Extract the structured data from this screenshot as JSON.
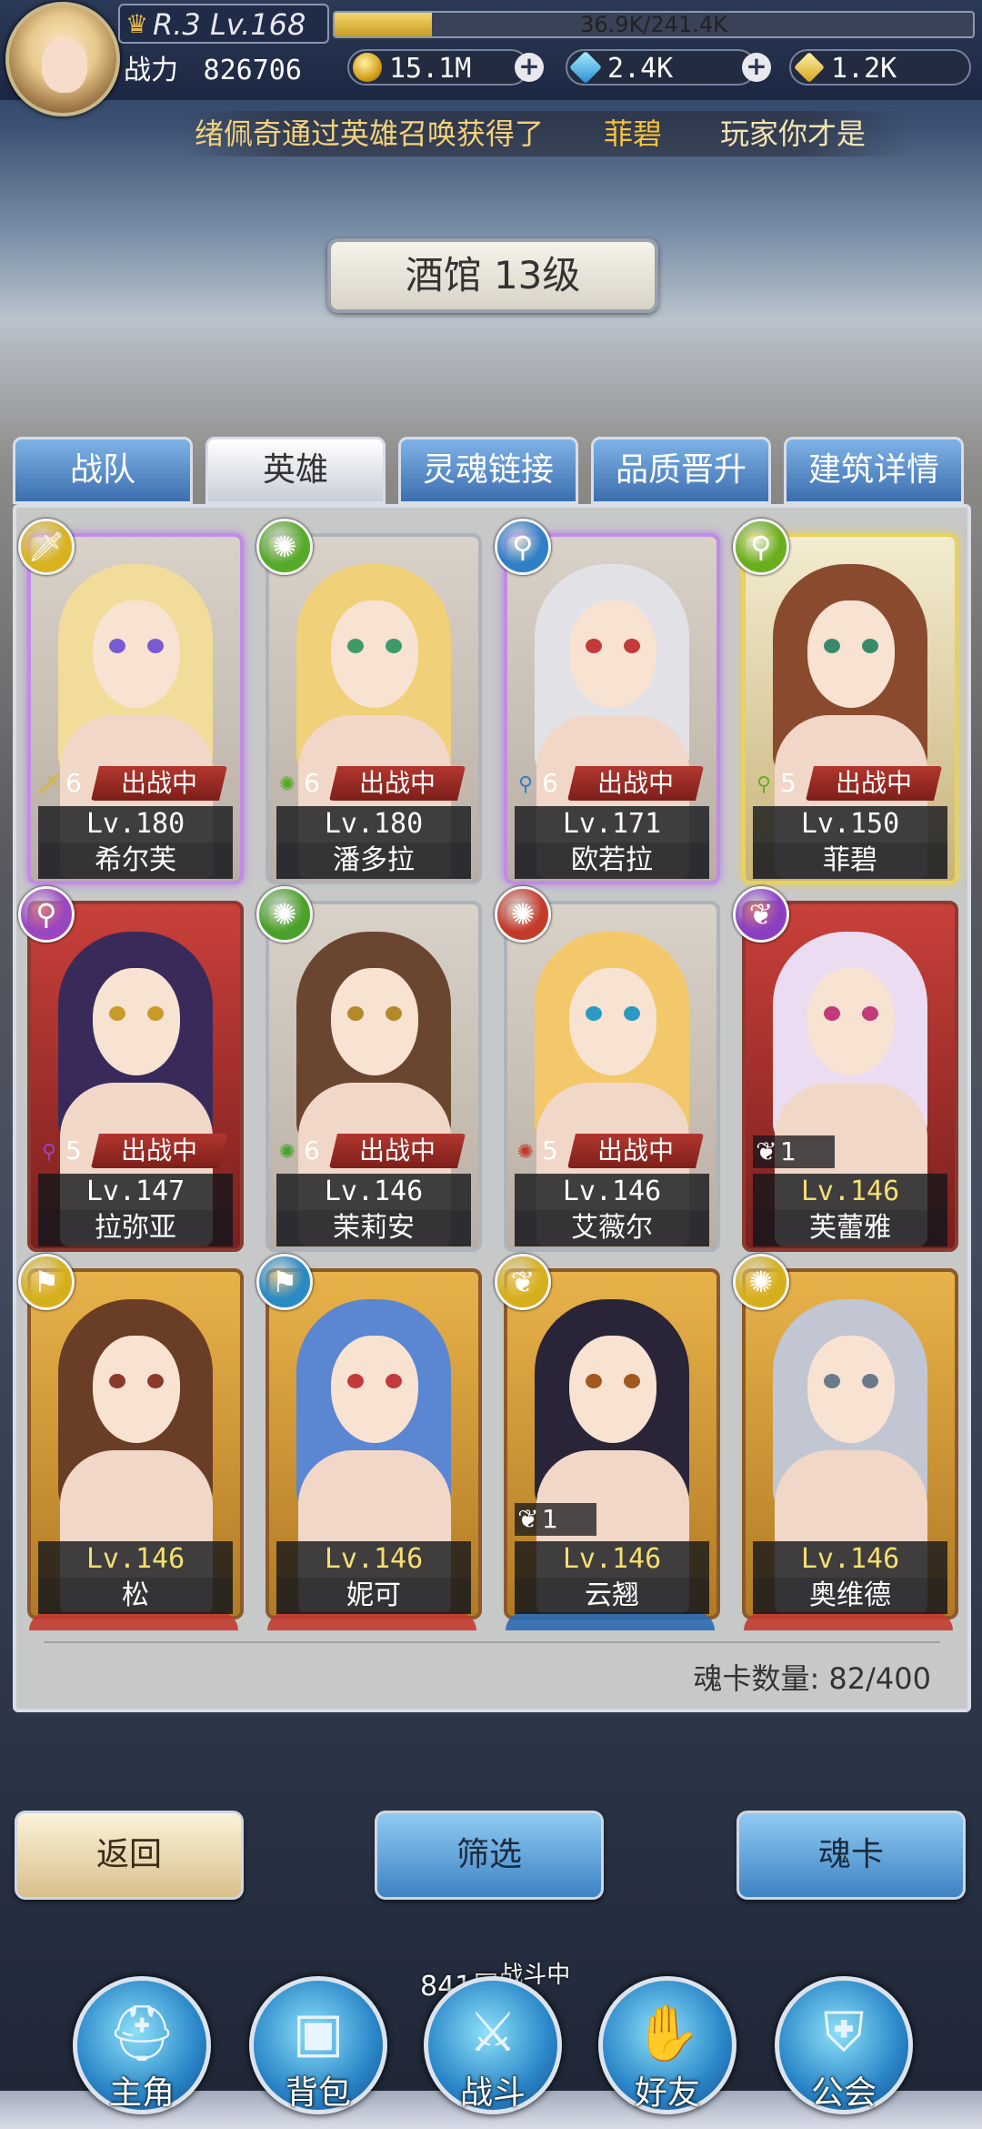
{
  "header": {
    "rank_level": "R.3 Lv.168",
    "exp_text": "36.9K/241.4K",
    "exp_fraction": 0.153,
    "power_label": "战力",
    "power_value": "826706",
    "gold": "15.1M",
    "gems": "2.4K",
    "crystals": "1.2K",
    "plus": "+"
  },
  "marquee": {
    "part1": "绪佩奇通过英雄召唤获得了",
    "hero": "菲碧",
    "part2": "玩家你才是"
  },
  "title": "酒馆 13级",
  "tabs": [
    "战队",
    "英雄",
    "灵魂链接",
    "品质晋升",
    "建筑详情"
  ],
  "selected_tab": 1,
  "heroes": [
    {
      "name": "希尔芙",
      "level": "Lv.180",
      "stars": "6",
      "status": "出战中",
      "element_icon": "sword-icon",
      "element_color": "#d9b21d",
      "frame": "purple",
      "hair": "#f2dc9a",
      "eye": "#7a5ad0"
    },
    {
      "name": "潘多拉",
      "level": "Lv.180",
      "stars": "6",
      "status": "出战中",
      "element_icon": "wind-icon",
      "element_color": "#57a92a",
      "frame": "silver",
      "hair": "#f0d078",
      "eye": "#3f9a6a"
    },
    {
      "name": "欧若拉",
      "level": "Lv.171",
      "stars": "6",
      "status": "出战中",
      "element_icon": "staff-icon",
      "element_color": "#2f7fc6",
      "frame": "purple",
      "hair": "#e2e2e6",
      "eye": "#c23a3a"
    },
    {
      "name": "菲碧",
      "level": "Lv.150",
      "stars": "5",
      "status": "出战中",
      "element_icon": "staff-icon",
      "element_color": "#6aae1e",
      "frame": "gold",
      "hair": "#8a4a2e",
      "eye": "#3a8a6a"
    },
    {
      "name": "拉弥亚",
      "level": "Lv.147",
      "stars": "5",
      "status": "出战中",
      "element_icon": "staff-icon",
      "element_color": "#9a45c2",
      "frame": "red",
      "hair": "#3a2a5a",
      "eye": "#c99a2a"
    },
    {
      "name": "茉莉安",
      "level": "Lv.146",
      "stars": "6",
      "status": "出战中",
      "element_icon": "wind-icon",
      "element_color": "#4aa12a",
      "frame": "silver",
      "hair": "#6a4630",
      "eye": "#b38a2a"
    },
    {
      "name": "艾薇尔",
      "level": "Lv.146",
      "stars": "5",
      "status": "出战中",
      "element_icon": "wind-icon",
      "element_color": "#c43a2a",
      "frame": "silver",
      "hair": "#f2c86a",
      "eye": "#2a9ac2"
    },
    {
      "name": "芙蕾雅",
      "level": "Lv.146",
      "stars": "1",
      "status": "",
      "element_icon": "wings-icon",
      "element_color": "#8a3fc2",
      "frame": "red",
      "hair": "#ecdcf2",
      "eye": "#c23a7a"
    },
    {
      "name": "松",
      "level": "Lv.146",
      "stars": "",
      "status": "",
      "element_icon": "flag-icon",
      "element_color": "#d6b01c",
      "frame": "orange",
      "hair": "#6a3e26",
      "eye": "#8a3a2a"
    },
    {
      "name": "妮可",
      "level": "Lv.146",
      "stars": "",
      "status": "",
      "element_icon": "flag-icon",
      "element_color": "#2a8ac2",
      "frame": "orange",
      "hair": "#5a86d2",
      "eye": "#c23a3a"
    },
    {
      "name": "云翘",
      "level": "Lv.146",
      "stars": "1",
      "status": "",
      "element_icon": "wings-icon",
      "element_color": "#d6b01c",
      "frame": "orange",
      "hair": "#2a2438",
      "eye": "#a2581e"
    },
    {
      "name": "奥维德",
      "level": "Lv.146",
      "stars": "",
      "status": "",
      "element_icon": "wind-icon",
      "element_color": "#d6b01c",
      "frame": "orange",
      "hair": "#c2c6d2",
      "eye": "#6a7a8a"
    }
  ],
  "card_count_label": "魂卡数量: 82/400",
  "buttons": {
    "back": "返回",
    "filter": "筛选",
    "soul_card": "魂卡"
  },
  "battle_floor": "841层",
  "battle_status": "战斗中",
  "nav": [
    {
      "label": "主角",
      "icon": "helmet-icon"
    },
    {
      "label": "背包",
      "icon": "backpack-icon"
    },
    {
      "label": "战斗",
      "icon": "crossed-swords-icon"
    },
    {
      "label": "好友",
      "icon": "handshake-icon"
    },
    {
      "label": "公会",
      "icon": "guild-crest-icon"
    }
  ]
}
